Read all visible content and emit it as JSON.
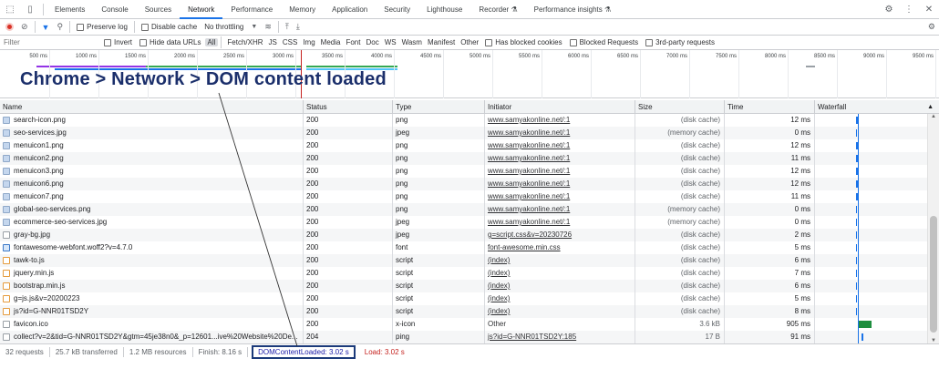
{
  "tabs": [
    "Elements",
    "Console",
    "Sources",
    "Network",
    "Performance",
    "Memory",
    "Application",
    "Security",
    "Lighthouse",
    "Recorder",
    "Performance insights"
  ],
  "active_tab": "Network",
  "toolbar": {
    "preserve_log": "Preserve log",
    "disable_cache": "Disable cache",
    "throttling": "No throttling"
  },
  "filterbar": {
    "placeholder": "Filter",
    "invert": "Invert",
    "hide_data_urls": "Hide data URLs",
    "types": [
      "All",
      "Fetch/XHR",
      "JS",
      "CSS",
      "Img",
      "Media",
      "Font",
      "Doc",
      "WS",
      "Wasm",
      "Manifest",
      "Other"
    ],
    "has_blocked_cookies": "Has blocked cookies",
    "blocked_requests": "Blocked Requests",
    "third_party": "3rd-party requests"
  },
  "overview": {
    "ticks": [
      "500 ms",
      "1000 ms",
      "1500 ms",
      "2000 ms",
      "2500 ms",
      "3000 ms",
      "3500 ms",
      "4000 ms",
      "4500 ms",
      "5000 ms",
      "5500 ms",
      "6000 ms",
      "6500 ms",
      "7000 ms",
      "7500 ms",
      "8000 ms",
      "8500 ms",
      "9000 ms",
      "9500 ms"
    ]
  },
  "headline": "Chrome > Network > DOM content loaded",
  "columns": [
    "Name",
    "Status",
    "Type",
    "Initiator",
    "Size",
    "Time",
    "Waterfall"
  ],
  "rows": [
    {
      "name": "search-icon.png",
      "status": "200",
      "type": "png",
      "initiator": "www.samyakonline.net/:1",
      "size": "(disk cache)",
      "time": "12 ms",
      "icon": "img"
    },
    {
      "name": "seo-services.jpg",
      "status": "200",
      "type": "jpeg",
      "initiator": "www.samyakonline.net/:1",
      "size": "(memory cache)",
      "time": "0 ms",
      "icon": "img"
    },
    {
      "name": "menuicon1.png",
      "status": "200",
      "type": "png",
      "initiator": "www.samyakonline.net/:1",
      "size": "(disk cache)",
      "time": "12 ms",
      "icon": "img"
    },
    {
      "name": "menuicon2.png",
      "status": "200",
      "type": "png",
      "initiator": "www.samyakonline.net/:1",
      "size": "(disk cache)",
      "time": "11 ms",
      "icon": "img"
    },
    {
      "name": "menuicon3.png",
      "status": "200",
      "type": "png",
      "initiator": "www.samyakonline.net/:1",
      "size": "(disk cache)",
      "time": "12 ms",
      "icon": "img"
    },
    {
      "name": "menuicon6.png",
      "status": "200",
      "type": "png",
      "initiator": "www.samyakonline.net/:1",
      "size": "(disk cache)",
      "time": "12 ms",
      "icon": "img"
    },
    {
      "name": "menuicon7.png",
      "status": "200",
      "type": "png",
      "initiator": "www.samyakonline.net/:1",
      "size": "(disk cache)",
      "time": "11 ms",
      "icon": "img"
    },
    {
      "name": "global-seo-services.png",
      "status": "200",
      "type": "png",
      "initiator": "www.samyakonline.net/:1",
      "size": "(memory cache)",
      "time": "0 ms",
      "icon": "img"
    },
    {
      "name": "ecommerce-seo-services.jpg",
      "status": "200",
      "type": "jpeg",
      "initiator": "www.samyakonline.net/:1",
      "size": "(memory cache)",
      "time": "0 ms",
      "icon": "img"
    },
    {
      "name": "gray-bg.jpg",
      "status": "200",
      "type": "jpeg",
      "initiator": "g=script.css&v=20230726",
      "size": "(disk cache)",
      "time": "2 ms",
      "icon": "doc"
    },
    {
      "name": "fontawesome-webfont.woff2?v=4.7.0",
      "status": "200",
      "type": "font",
      "initiator": "font-awesome.min.css",
      "size": "(disk cache)",
      "time": "5 ms",
      "icon": "font"
    },
    {
      "name": "tawk-to.js",
      "status": "200",
      "type": "script",
      "initiator": "(index)",
      "size": "(disk cache)",
      "time": "6 ms",
      "icon": "script"
    },
    {
      "name": "jquery.min.js",
      "status": "200",
      "type": "script",
      "initiator": "(index)",
      "size": "(disk cache)",
      "time": "7 ms",
      "icon": "script"
    },
    {
      "name": "bootstrap.min.js",
      "status": "200",
      "type": "script",
      "initiator": "(index)",
      "size": "(disk cache)",
      "time": "6 ms",
      "icon": "script"
    },
    {
      "name": "g=js.js&v=20200223",
      "status": "200",
      "type": "script",
      "initiator": "(index)",
      "size": "(disk cache)",
      "time": "5 ms",
      "icon": "script"
    },
    {
      "name": "js?id=G-NNR01TSD2Y",
      "status": "200",
      "type": "script",
      "initiator": "(index)",
      "size": "(disk cache)",
      "time": "8 ms",
      "icon": "script"
    },
    {
      "name": "favicon.ico",
      "status": "200",
      "type": "x-icon",
      "initiator": "Other",
      "size": "3.6 kB",
      "time": "905 ms",
      "icon": "doc"
    },
    {
      "name": "collect?v=2&tid=G-NNR01TSD2Y&gtm=45je38n0&_p=12601...ive%20Website%20De...",
      "status": "204",
      "type": "ping",
      "initiator": "js?id=G-NNR01TSD2Y:185",
      "size": "17 B",
      "time": "91 ms",
      "icon": "doc"
    }
  ],
  "statusbar": {
    "requests": "32 requests",
    "transferred": "25.7 kB transferred",
    "resources": "1.2 MB resources",
    "finish": "Finish: 8.16 s",
    "dcl": "DOMContentLoaded: 3.02 s",
    "load": "Load: 3.02 s"
  },
  "colors": {
    "accent": "#1a73e8",
    "dcl_line": "#1a1aa6",
    "load_line": "#c5221f",
    "headline": "#1b2f6b"
  }
}
